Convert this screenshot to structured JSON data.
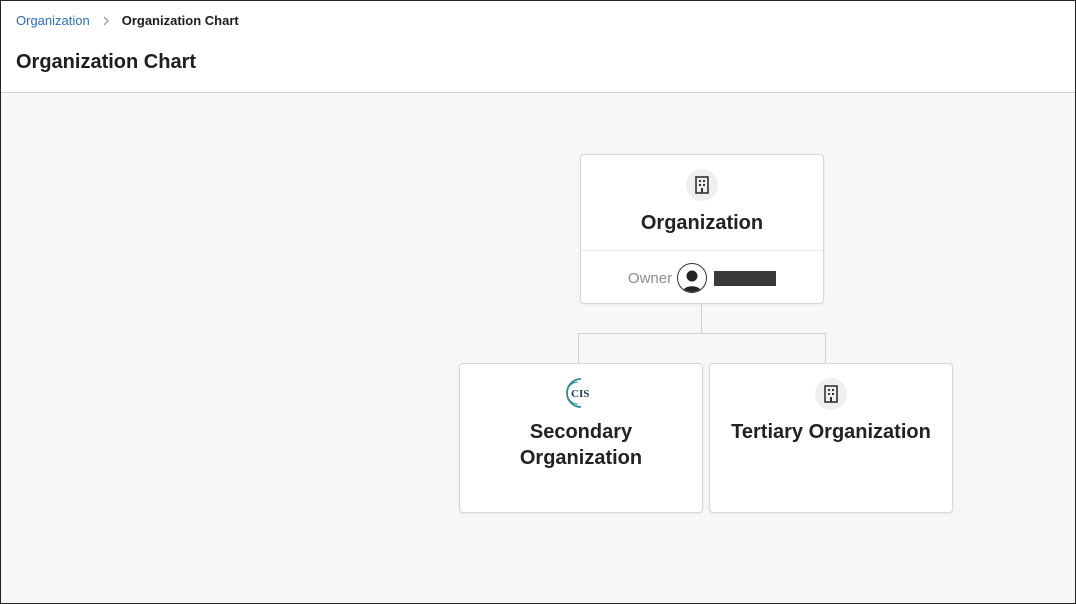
{
  "breadcrumb": {
    "link_label": "Organization",
    "current_label": "Organization Chart"
  },
  "page": {
    "title": "Organization Chart"
  },
  "org_chart": {
    "root": {
      "name": "Organization",
      "icon": "building-icon",
      "owner_label": "Owner",
      "owner_avatar": "user-avatar-icon",
      "owner_name_redacted": true
    },
    "children": [
      {
        "name": "Secondary Organization",
        "icon": "cis-logo",
        "logo_text": "CIS"
      },
      {
        "name": "Tertiary Organization",
        "icon": "building-icon"
      }
    ]
  },
  "colors": {
    "link": "#2f6fae",
    "canvas_bg": "#f7f7f7",
    "card_border": "#d6d6d6",
    "connector": "#cfcfcf",
    "logo_teal": "#2a8a8a"
  }
}
